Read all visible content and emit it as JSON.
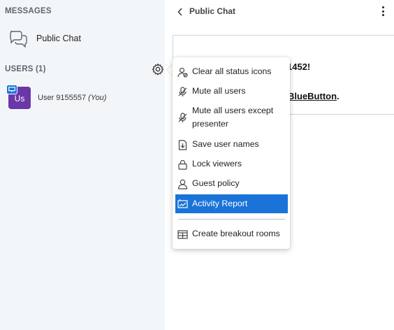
{
  "sidebar": {
    "messages_title": "MESSAGES",
    "chat_label": "Public Chat",
    "users_title": "USERS (1)",
    "user": {
      "initials": "Us",
      "name": "User 9155557",
      "you_label": "(You)",
      "avatar_color": "#6a37a8"
    }
  },
  "header": {
    "title": "Public Chat"
  },
  "welcome": {
    "line1": "1452!",
    "line2_link": "BlueButton",
    "line2_suffix": "."
  },
  "menu": {
    "items": [
      {
        "label": "Clear all status icons",
        "icon": "clear-status-icon"
      },
      {
        "label": "Mute all users",
        "icon": "mute-icon"
      },
      {
        "label_line1": "Mute all users except",
        "label_line2": "presenter",
        "icon": "mute-icon"
      },
      {
        "label": "Save user names",
        "icon": "save-icon"
      },
      {
        "label": "Lock viewers",
        "icon": "lock-icon"
      },
      {
        "label": "Guest policy",
        "icon": "user-icon"
      },
      {
        "label": "Activity Report",
        "icon": "activity-report-icon",
        "active": true
      },
      {
        "label": "Create breakout rooms",
        "icon": "breakout-rooms-icon"
      }
    ]
  },
  "colors": {
    "accent": "#1a73d8",
    "sidebar_bg": "#f3f6f9"
  }
}
